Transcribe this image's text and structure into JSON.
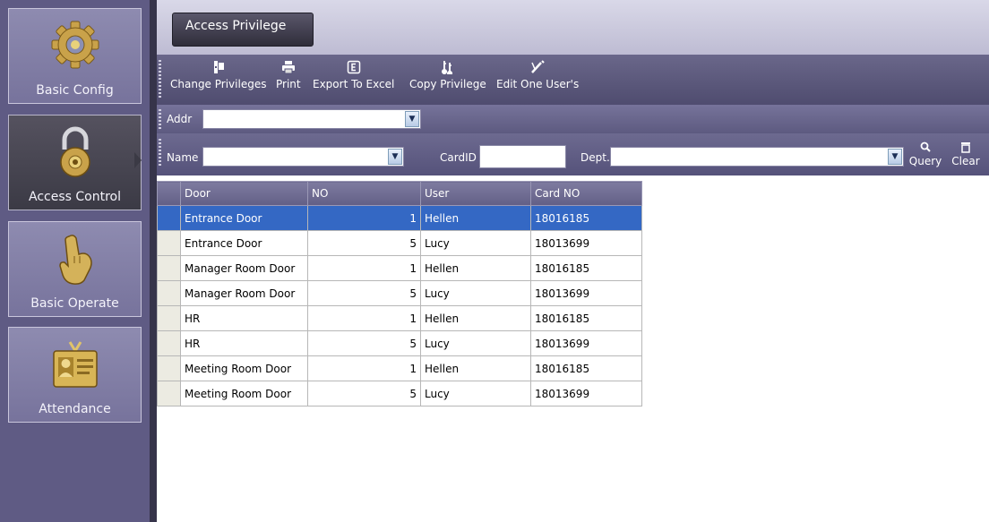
{
  "sidebar": {
    "items": [
      {
        "label": "Basic Config",
        "icon": "gear-icon",
        "active": false
      },
      {
        "label": "Access Control",
        "icon": "padlock-icon",
        "active": true
      },
      {
        "label": "Basic Operate",
        "icon": "pointing-hand-icon",
        "active": false
      },
      {
        "label": "Attendance",
        "icon": "id-card-icon",
        "active": false
      }
    ]
  },
  "tabs": {
    "active": "Access Privilege"
  },
  "toolbar": {
    "change_privileges": "Change Privileges",
    "print": "Print",
    "export_to_excel": "Export To Excel",
    "copy_privilege": "Copy Privilege",
    "edit_one_user": "Edit One User's"
  },
  "filters": {
    "addr_label": "Addr",
    "addr_value": "",
    "name_label": "Name",
    "name_value": "",
    "cardid_label": "CardID",
    "cardid_value": "",
    "dept_label": "Dept.",
    "dept_value": "",
    "query_label": "Query",
    "clear_label": "Clear"
  },
  "grid": {
    "columns": [
      "Door",
      "NO",
      "User",
      "Card NO"
    ],
    "selected_row": 0,
    "rows": [
      [
        "Entrance Door",
        "1",
        "Hellen",
        "18016185"
      ],
      [
        "Entrance Door",
        "5",
        "Lucy",
        "18013699"
      ],
      [
        "Manager Room Door",
        "1",
        "Hellen",
        "18016185"
      ],
      [
        "Manager Room Door",
        "5",
        "Lucy",
        "18013699"
      ],
      [
        "HR",
        "1",
        "Hellen",
        "18016185"
      ],
      [
        "HR",
        "5",
        "Lucy",
        "18013699"
      ],
      [
        "Meeting Room Door",
        "1",
        "Hellen",
        "18016185"
      ],
      [
        "Meeting Room Door",
        "5",
        "Lucy",
        "18013699"
      ]
    ]
  },
  "colors": {
    "sidebar_bg": "#5f5b84",
    "selection": "#3468c4",
    "toolbar": "#5c5980"
  }
}
